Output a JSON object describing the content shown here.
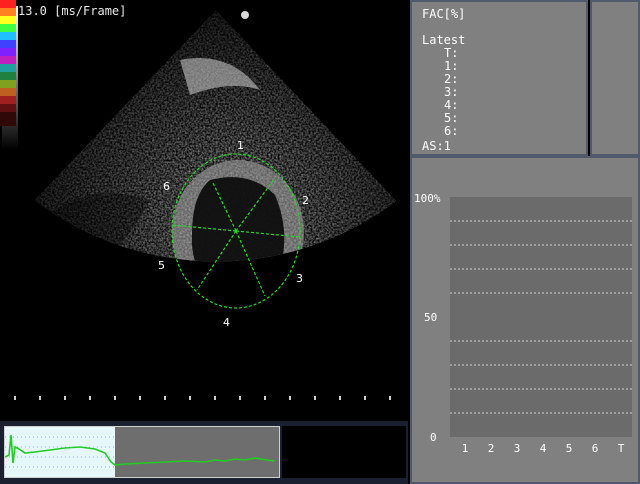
{
  "viewport": {
    "frame_rate_label": "13.0 [ms/Frame]",
    "segment_labels": [
      "1",
      "2",
      "3",
      "4",
      "5",
      "6"
    ]
  },
  "fac_panel": {
    "title": "FAC[%]",
    "latest_label": "Latest",
    "rows": [
      "T:",
      "1:",
      "2:",
      "3:",
      "4:",
      "5:",
      "6:"
    ],
    "as_label": "AS:1"
  },
  "graph": {
    "y_labels": [
      "100%",
      "50",
      "0"
    ],
    "x_labels": [
      "1",
      "2",
      "3",
      "4",
      "5",
      "6",
      "T"
    ]
  },
  "colors": {
    "overlay_green": "#22dd22",
    "panel_gray": "#808080",
    "panel_border": "#505a6c",
    "plot_gray": "#6b6b6b"
  }
}
